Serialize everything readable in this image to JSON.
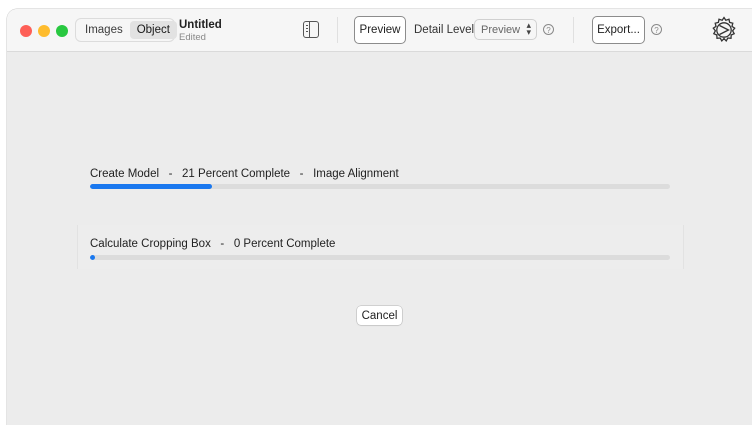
{
  "toolbar": {
    "mode_tabs": [
      {
        "label": "Images",
        "active": false
      },
      {
        "label": "Object",
        "active": true
      }
    ],
    "document_title": "Untitled",
    "document_status": "Edited",
    "preview_button": "Preview",
    "detail_level_label": "Detail Level",
    "detail_level_value": "Preview",
    "export_button": "Export...",
    "help_glyph": "?",
    "icons": [
      "sidebar-toggle-icon",
      "help-icon",
      "gear-icon"
    ]
  },
  "tasks": [
    {
      "label": "Create Model   -   21 Percent Complete   -   Image Alignment",
      "progress_fraction": 0.21
    },
    {
      "label": "Calculate Cropping Box   -   0 Percent Complete",
      "progress_fraction": 0.0
    }
  ],
  "cancel_label": "Cancel",
  "colors": {
    "accent": "#1a78ef",
    "track": "#dcdcdc",
    "window_bg": "#ececec",
    "close": "#fe5f57",
    "minimize": "#febc2e",
    "maximize": "#28c840"
  }
}
